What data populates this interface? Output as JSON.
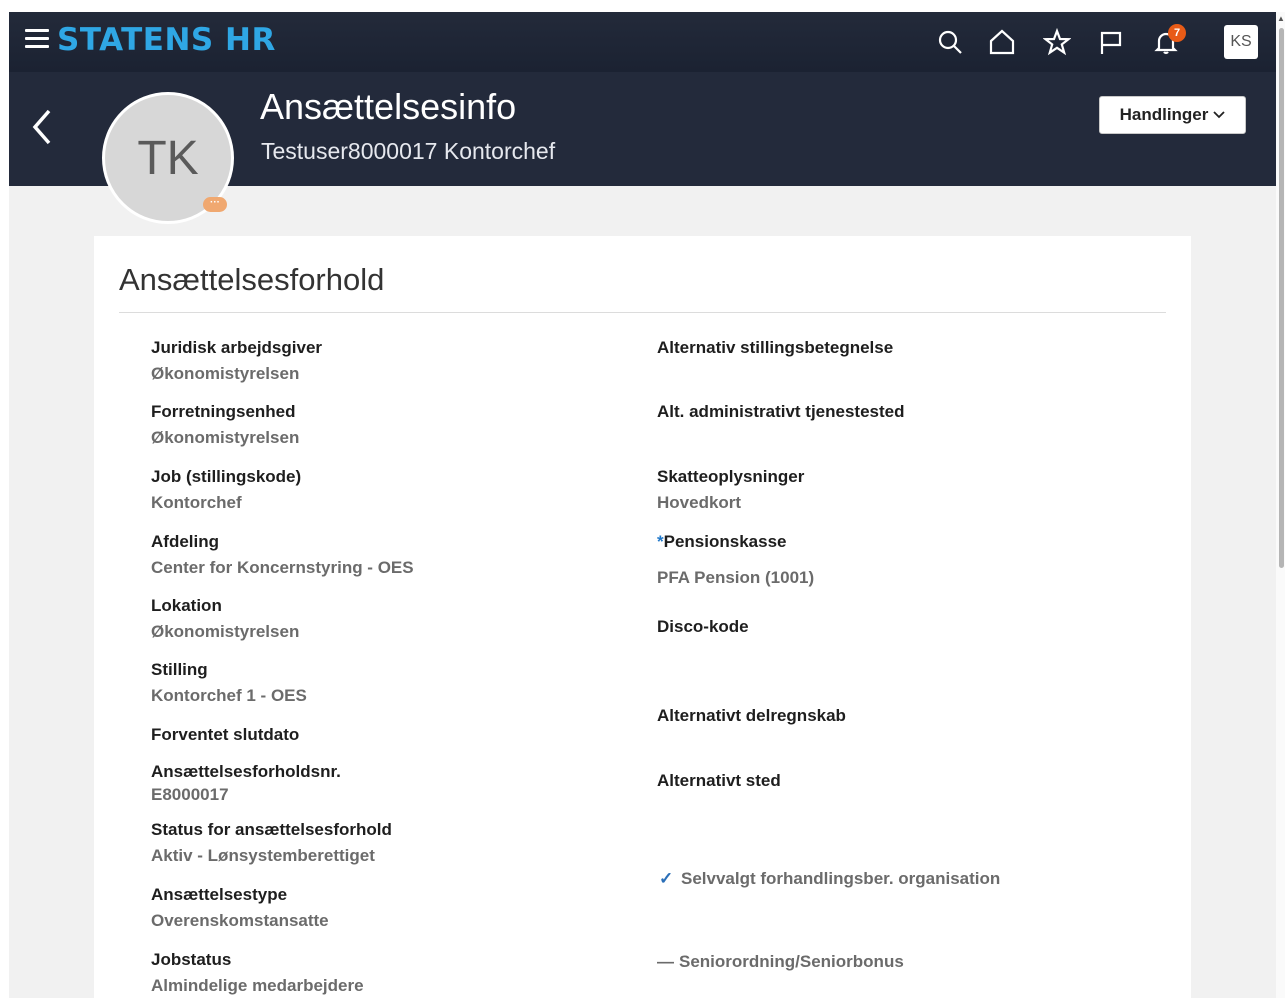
{
  "brand": {
    "logo": "STATENS HR"
  },
  "global_icons": [
    "search-icon",
    "home-icon",
    "star-icon",
    "flag-icon",
    "bell-icon"
  ],
  "notifications": {
    "count": "7"
  },
  "user": {
    "initials": "KS"
  },
  "header": {
    "title": "Ansættelsesinfo",
    "subtitle": "Testuser8000017 Kontorchef",
    "avatar_initials": "TK",
    "avatar_dot": "···",
    "actions_label": "Handlinger"
  },
  "section": {
    "title": "Ansættelsesforhold"
  },
  "left_fields": [
    {
      "label": "Juridisk arbejdsgiver",
      "value": "Økonomistyrelsen"
    },
    {
      "label": "Forretningsenhed",
      "value": "Økonomistyrelsen"
    },
    {
      "label": "Job (stillingskode)",
      "value": "Kontorchef"
    },
    {
      "label": "Afdeling",
      "value": "Center for Koncernstyring - OES"
    },
    {
      "label": "Lokation",
      "value": "Økonomistyrelsen"
    },
    {
      "label": "Stilling",
      "value": "Kontorchef 1 - OES"
    },
    {
      "label": "Forventet slutdato",
      "value": ""
    },
    {
      "label": "Ansættelsesforholdsnr.",
      "value": "E8000017"
    },
    {
      "label": "Status for ansættelsesforhold",
      "value": "Aktiv - Lønsystemberettiget"
    },
    {
      "label": "Ansættelsestype",
      "value": "Overenskomstansatte"
    },
    {
      "label": "Jobstatus",
      "value": "Almindelige medarbejdere"
    }
  ],
  "right_fields": [
    {
      "label": "Alternativ stillingsbetegnelse",
      "value": ""
    },
    {
      "label": "Alt. administrativt tjenestested",
      "value": ""
    },
    {
      "label": "Skatteoplysninger",
      "value": "Hovedkort"
    },
    {
      "label": "Pensionskasse",
      "required_mark": "*",
      "value": "PFA Pension (1001)"
    },
    {
      "label": "Disco-kode",
      "value": ""
    },
    {
      "label": "Alternativt delregnskab",
      "value": ""
    },
    {
      "label": "Alternativt sted",
      "value": ""
    }
  ],
  "flags": [
    {
      "mark": "✓",
      "label": "Selvvalgt forhandlingsber. organisation",
      "checked": true
    },
    {
      "mark": "—",
      "label": "Seniorordning/Seniorbonus",
      "checked": false
    }
  ],
  "colors": {
    "brand_blue": "#2fa7e5",
    "header_bg": "#232a3b",
    "badge": "#e85b17",
    "page_bg": "#f1f1f1"
  }
}
